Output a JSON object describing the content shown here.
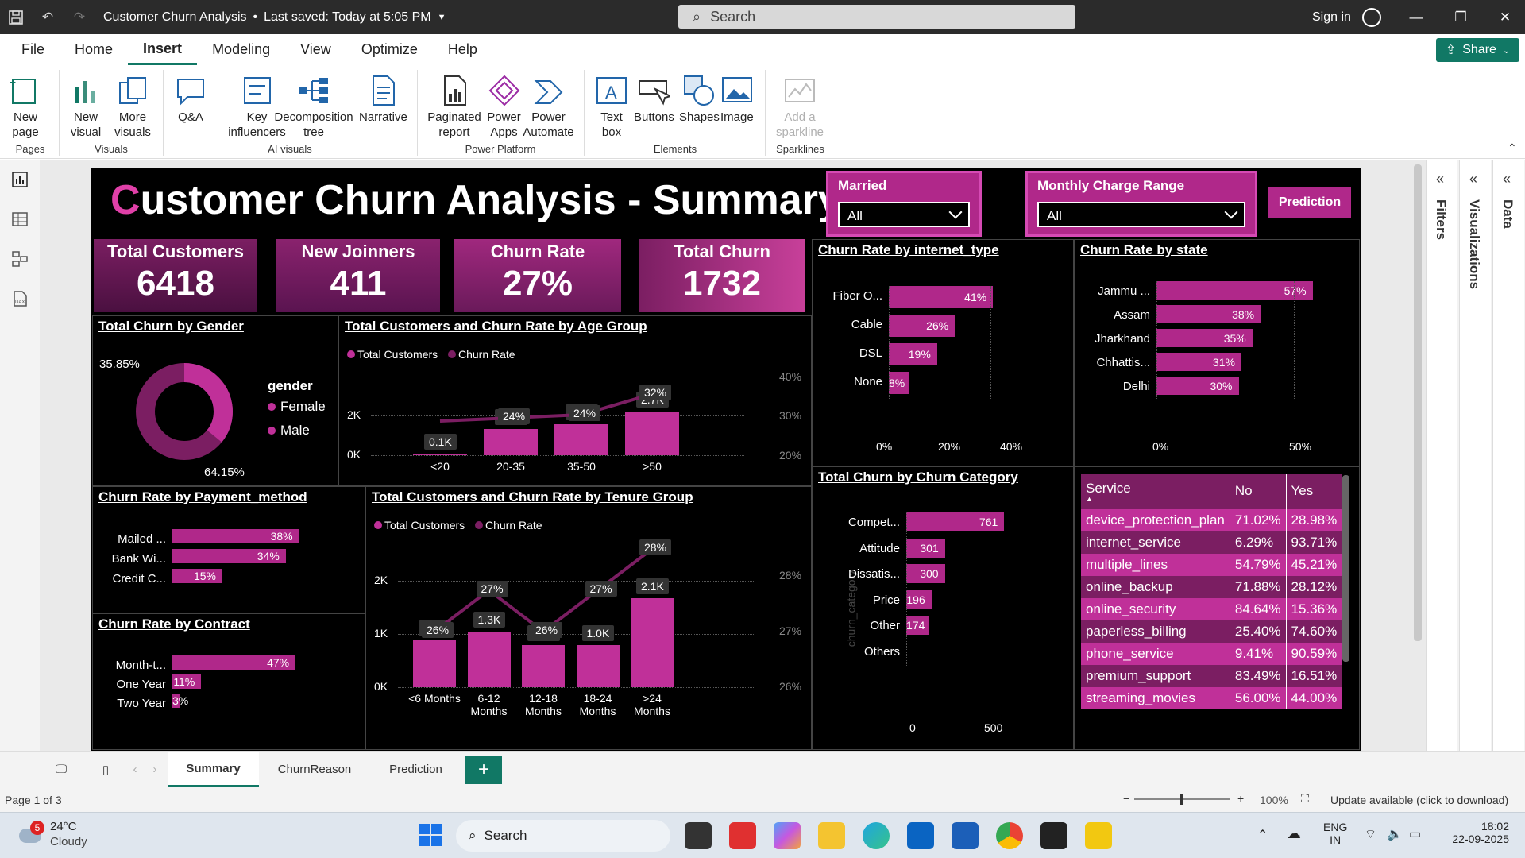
{
  "window": {
    "title": "Customer Churn Analysis",
    "saved": "Last saved: Today at 5:05 PM",
    "search_placeholder": "Search",
    "signin": "Sign in"
  },
  "menu": {
    "items": [
      "File",
      "Home",
      "Insert",
      "Modeling",
      "View",
      "Optimize",
      "Help"
    ],
    "active": "Insert",
    "share": "Share"
  },
  "ribbon": {
    "buttons": [
      {
        "label": "New page",
        "arrow": true
      },
      {
        "label": "New visual"
      },
      {
        "label": "More visuals",
        "arrow": true
      },
      {
        "label": "Q&A"
      },
      {
        "label": "Key influencers"
      },
      {
        "label": "Decomposition tree"
      },
      {
        "label": "Narrative"
      },
      {
        "label": "Paginated report"
      },
      {
        "label": "Power Apps"
      },
      {
        "label": "Power Automate"
      },
      {
        "label": "Text box"
      },
      {
        "label": "Buttons",
        "arrow": true
      },
      {
        "label": "Shapes",
        "arrow": true
      },
      {
        "label": "Image"
      },
      {
        "label": "Add a sparkline"
      }
    ],
    "groups": [
      "Pages",
      "Visuals",
      "AI visuals",
      "Power Platform",
      "Elements",
      "Sparklines"
    ]
  },
  "report": {
    "title_first": "C",
    "title_rest": "ustomer Churn Analysis - Summary",
    "slicers": [
      {
        "label": "Married",
        "value": "All"
      },
      {
        "label": "Monthly Charge Range",
        "value": "All"
      }
    ],
    "prediction_button": "Prediction",
    "kpis": [
      {
        "label": "Total Customers",
        "value": "6418"
      },
      {
        "label": "New Joinners",
        "value": "411"
      },
      {
        "label": "Churn Rate",
        "value": "27%"
      },
      {
        "label": "Total Churn",
        "value": "1732"
      }
    ],
    "gender": {
      "title": "Total Churn by Gender",
      "legend_title": "gender",
      "legend": [
        "Female",
        "Male"
      ],
      "female_pct": "35.85%",
      "male_pct": "64.15%",
      "colors": {
        "female": "#c03099",
        "male": "#7b1e62"
      }
    },
    "age": {
      "title": "Total Customers and Churn Rate by Age Group",
      "legend": [
        "Total Customers",
        "Churn Rate"
      ],
      "categories": [
        "<20",
        "20-35",
        "35-50",
        ">50"
      ],
      "customers": [
        100,
        1600,
        1900,
        2700
      ],
      "customers_labels": [
        "0.1K",
        "1.6K",
        "1.9K",
        "2.7K"
      ],
      "rate_labels": [
        "",
        "24%",
        "24%",
        "32%"
      ],
      "yleft": [
        "0K",
        "2K"
      ],
      "yright": [
        "20%",
        "30%",
        "40%"
      ]
    },
    "internet": {
      "title": "Churn Rate by internet_type",
      "categories": [
        "Fiber O...",
        "Cable",
        "DSL",
        "None"
      ],
      "values": [
        41,
        26,
        19,
        8
      ],
      "axis": [
        "0%",
        "20%",
        "40%"
      ]
    },
    "state": {
      "title": "Churn Rate by state",
      "categories": [
        "Jammu ...",
        "Assam",
        "Jharkhand",
        "Chhattis...",
        "Delhi"
      ],
      "values": [
        57,
        38,
        35,
        31,
        30
      ],
      "axis": [
        "0%",
        "50%"
      ]
    },
    "payment": {
      "title": "Churn Rate by Payment_method",
      "categories": [
        "Mailed ...",
        "Bank Wi...",
        "Credit C..."
      ],
      "values": [
        38,
        34,
        15
      ]
    },
    "contract": {
      "title": "Churn Rate by Contract",
      "categories": [
        "Month-t...",
        "One Year",
        "Two Year"
      ],
      "values": [
        47,
        11,
        3
      ]
    },
    "tenure": {
      "title": "Total Customers and Churn Rate by Tenure Group",
      "legend": [
        "Total Customers",
        "Churn Rate"
      ],
      "categories": [
        "<6 Months",
        "6-12 Months",
        "12-18 Months",
        "18-24 Months",
        ">24 Months"
      ],
      "customers": [
        1100,
        1300,
        1000,
        1000,
        2100
      ],
      "customers_labels": [
        "1.1K",
        "1.3K",
        "1.0K",
        "1.0K",
        "2.1K"
      ],
      "rates": [
        26,
        27,
        26,
        27,
        28
      ],
      "rate_labels": [
        "26%",
        "27%",
        "26%",
        "27%",
        "28%"
      ],
      "yleft": [
        "0K",
        "1K",
        "2K"
      ],
      "yright": [
        "26%",
        "27%",
        "28%"
      ]
    },
    "category": {
      "title": "Total Churn by Churn Category",
      "axis_title": "churn_category",
      "categories": [
        "Compet...",
        "Attitude",
        "Dissatis...",
        "Price",
        "Other",
        "Others"
      ],
      "values": [
        761,
        301,
        300,
        196,
        174,
        0
      ],
      "axis": [
        "0",
        "500"
      ]
    },
    "services": {
      "headers": [
        "Service",
        "No",
        "Yes"
      ],
      "rows": [
        [
          "device_protection_plan",
          "71.02%",
          "28.98%"
        ],
        [
          "internet_service",
          "6.29%",
          "93.71%"
        ],
        [
          "multiple_lines",
          "54.79%",
          "45.21%"
        ],
        [
          "online_backup",
          "71.88%",
          "28.12%"
        ],
        [
          "online_security",
          "84.64%",
          "15.36%"
        ],
        [
          "paperless_billing",
          "25.40%",
          "74.60%"
        ],
        [
          "phone_service",
          "9.41%",
          "90.59%"
        ],
        [
          "premium_support",
          "83.49%",
          "16.51%"
        ],
        [
          "streaming_movies",
          "56.00%",
          "44.00%"
        ]
      ]
    }
  },
  "panes": [
    "Filters",
    "Visualizations",
    "Data"
  ],
  "tabs": [
    "Summary",
    "ChurnReason",
    "Prediction"
  ],
  "status": {
    "page": "Page 1 of 3",
    "zoom": "100%",
    "update": "Update available (click to download)"
  },
  "taskbar": {
    "temp": "24°C",
    "weather": "Cloudy",
    "badge": "5",
    "search": "Search",
    "lang1": "ENG",
    "lang2": "IN",
    "time": "18:02",
    "date": "22-09-2025"
  },
  "colors": {
    "accent": "#b0288a",
    "dark": "#7b1e62",
    "brand": "#117865"
  }
}
